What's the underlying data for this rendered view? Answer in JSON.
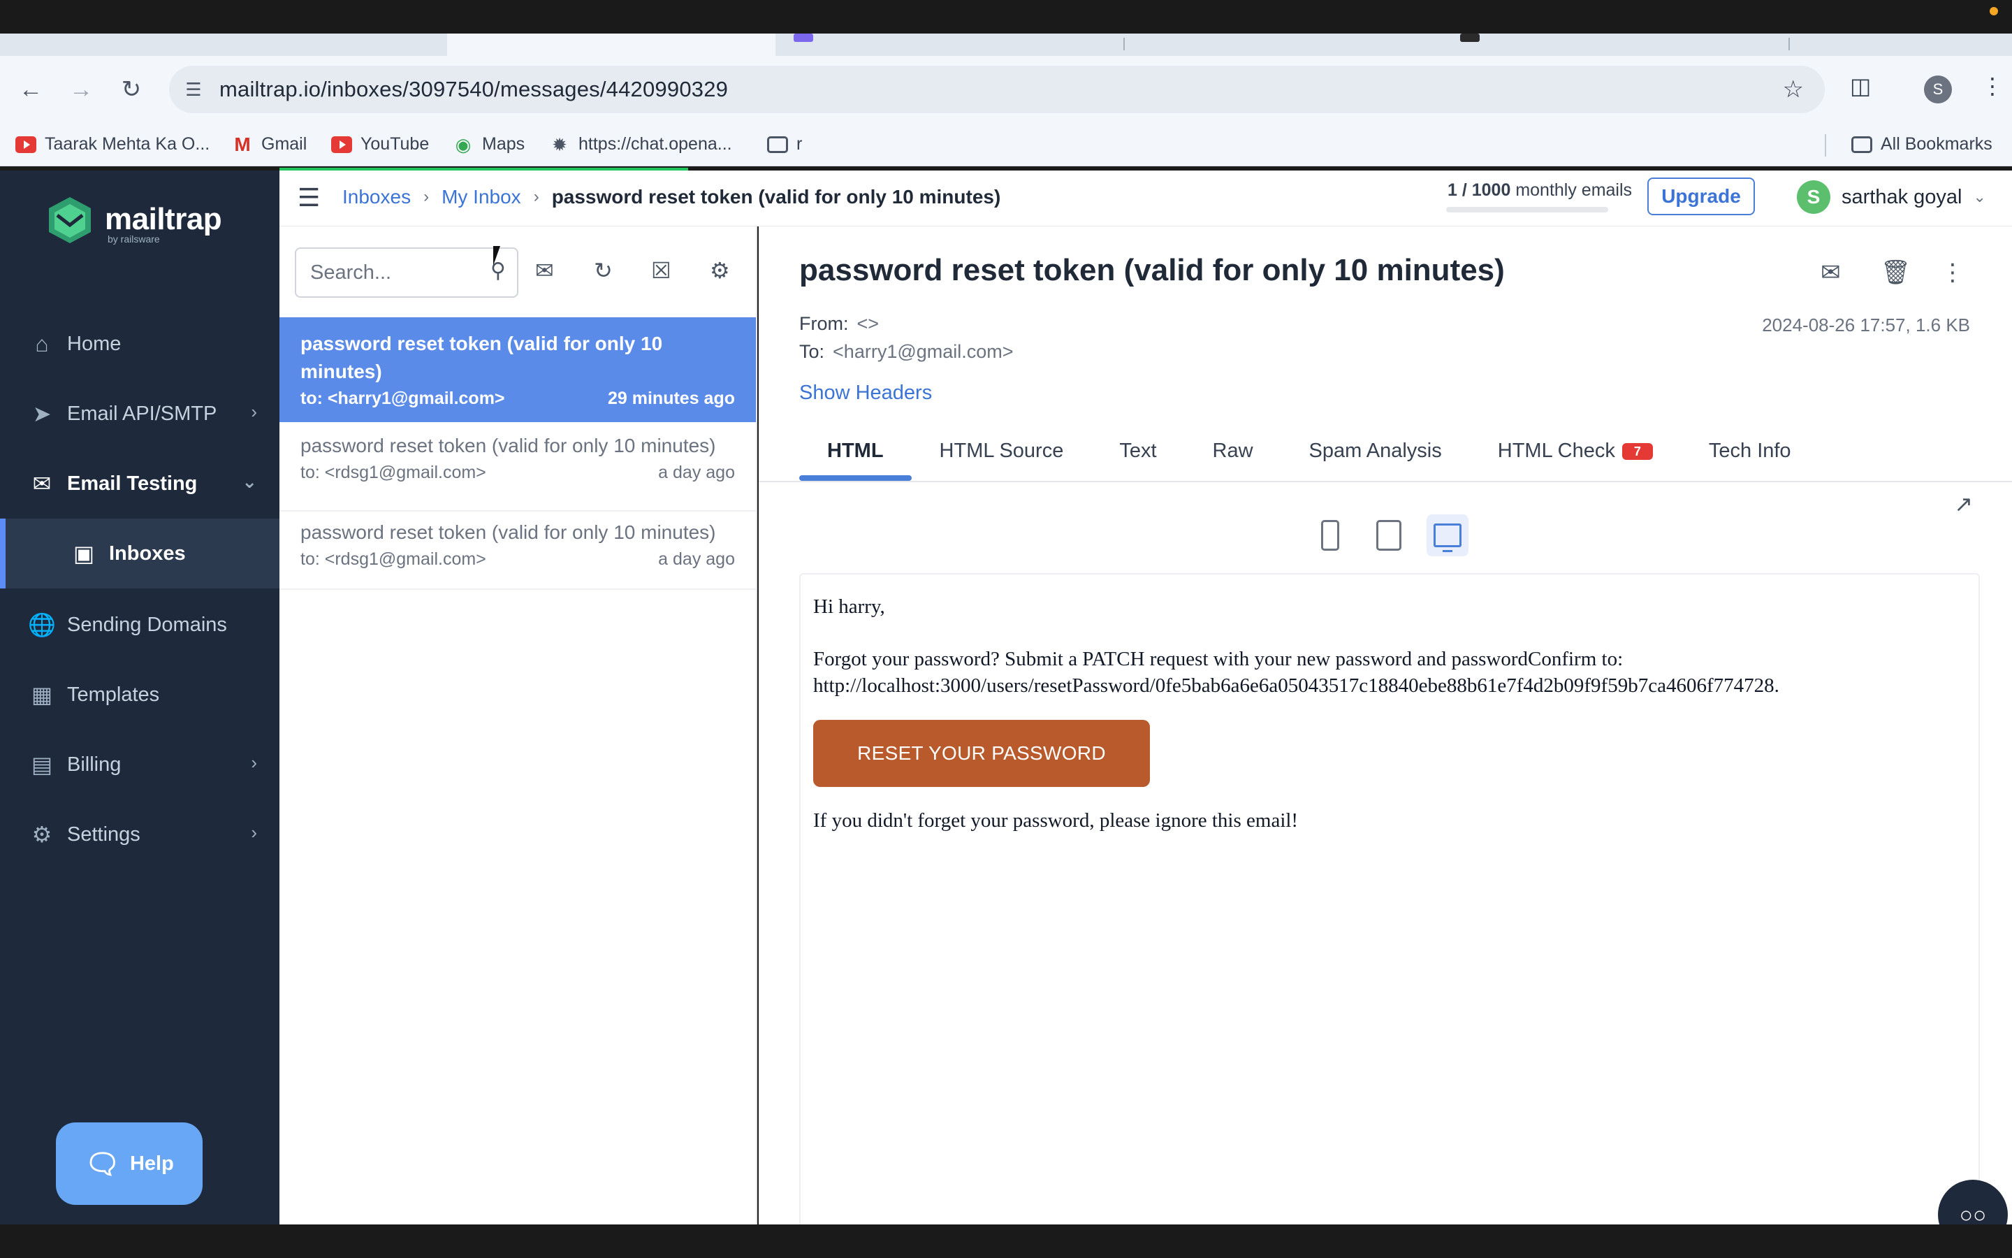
{
  "browser": {
    "url": "mailtrap.io/inboxes/3097540/messages/4420990329",
    "bookmarks": [
      {
        "label": "Taarak Mehta Ka O...",
        "icon": "youtube-icon"
      },
      {
        "label": "Gmail",
        "icon": "gmail-icon"
      },
      {
        "label": "YouTube",
        "icon": "youtube-icon"
      },
      {
        "label": "Maps",
        "icon": "maps-icon"
      },
      {
        "label": "https://chat.opena...",
        "icon": "openai-icon"
      },
      {
        "label": "r",
        "icon": "folder-icon"
      }
    ],
    "all_bookmarks": "All Bookmarks",
    "profile_initial": "S"
  },
  "sidebar": {
    "brand": "mailtrap",
    "brand_sub": "by railsware",
    "items": [
      {
        "label": "Home",
        "icon": "home-icon"
      },
      {
        "label": "Email API/SMTP",
        "icon": "send-icon"
      },
      {
        "label": "Email Testing",
        "icon": "mail-check-icon"
      },
      {
        "label": "Inboxes",
        "icon": "inbox-icon"
      },
      {
        "label": "Sending Domains",
        "icon": "globe-icon"
      },
      {
        "label": "Templates",
        "icon": "template-icon"
      },
      {
        "label": "Billing",
        "icon": "card-icon"
      },
      {
        "label": "Settings",
        "icon": "gear-icon"
      }
    ],
    "help": "Help"
  },
  "header": {
    "breadcrumbs": [
      "Inboxes",
      "My Inbox",
      "password reset token (valid for only 10 minutes)"
    ],
    "usage_count": "1 / 1000",
    "usage_label": "monthly emails",
    "usage_fraction": 0.001,
    "upgrade": "Upgrade",
    "user_initial": "S",
    "user_name": "sarthak goyal"
  },
  "list": {
    "search_placeholder": "Search...",
    "messages": [
      {
        "subject": "password reset token (valid for only 10 minutes)",
        "to": "to: <harry1@gmail.com>",
        "time": "29 minutes ago"
      },
      {
        "subject": "password reset token (valid for only 10 minutes)",
        "to": "to: <rdsg1@gmail.com>",
        "time": "a day ago"
      },
      {
        "subject": "password reset token (valid for only 10 minutes)",
        "to": "to: <rdsg1@gmail.com>",
        "time": "a day ago"
      }
    ]
  },
  "message": {
    "subject": "password reset token (valid for only 10 minutes)",
    "from_label": "From:",
    "from_value": "<>",
    "to_label": "To:",
    "to_value": "<harry1@gmail.com>",
    "date": "2024-08-26 17:57, 1.6 KB",
    "show_headers": "Show Headers",
    "tabs": [
      "HTML",
      "HTML Source",
      "Text",
      "Raw",
      "Spam Analysis",
      "HTML Check",
      "Tech Info"
    ],
    "html_check_badge": "7",
    "body": {
      "greeting": "Hi harry,",
      "paragraph1": "Forgot your password? Submit a PATCH request with your new password and passwordConfirm to: http://localhost:3000/users/resetPassword/0fe5bab6a6e6a05043517c18840ebe88b61e7f4d2b09f9f59b7ca4606f774728.",
      "button": "RESET YOUR PASSWORD",
      "paragraph2": "If you didn't forget your password, please ignore this email!"
    }
  },
  "colors": {
    "sidebar_bg": "#1e2a3b",
    "accent": "#4a7fd9",
    "active_message": "#5b8be8",
    "reset_button": "#b85a2c",
    "badge": "#e53935"
  }
}
